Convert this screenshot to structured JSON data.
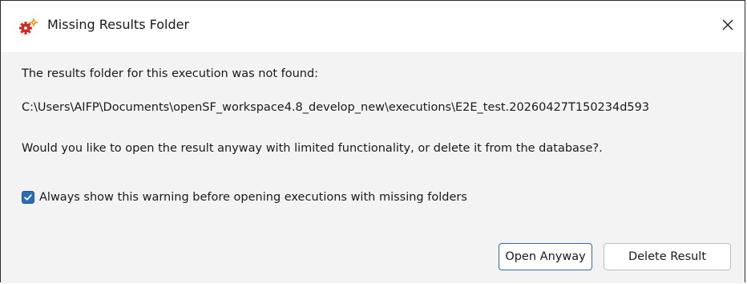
{
  "window": {
    "title": "Missing Results Folder",
    "icon": "gears-icon",
    "close_icon": "close-icon"
  },
  "message": {
    "line1": "The results folder for this execution was not found:",
    "path": "C:\\Users\\AIFP\\Documents\\openSF_workspace4.8_develop_new\\executions\\E2E_test.20260427T150234d593",
    "question": "Would you like to open the result anyway with limited functionality, or delete it from the database?."
  },
  "checkbox": {
    "label": "Always show this warning before opening executions with missing folders",
    "checked": true
  },
  "buttons": {
    "open_label": "Open Anyway",
    "delete_label": "Delete Result"
  },
  "colors": {
    "accent": "#2a6db8",
    "icon_red": "#d9261c",
    "icon_orange": "#f0a020"
  }
}
